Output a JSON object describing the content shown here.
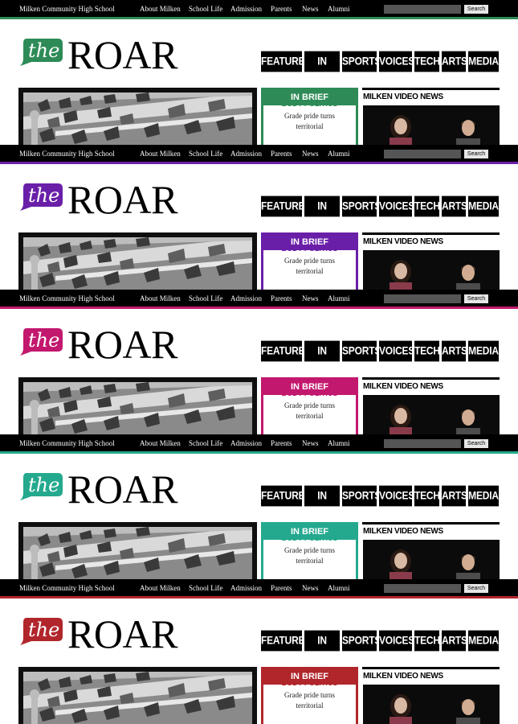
{
  "topbar": {
    "school_name": "Milken Community High School",
    "links": [
      "About Milken",
      "School Life",
      "Admission",
      "Parents",
      "News",
      "Alumni"
    ],
    "search_placeholder": "",
    "search_button": "Search"
  },
  "logo": {
    "the_text": "the",
    "roar_text": "ROAR"
  },
  "main_nav": [
    "FEATURES",
    "IN BRIEF",
    "SPORTS",
    "VOICES",
    "TECH",
    "ARTS",
    "MEDIA"
  ],
  "in_brief": {
    "header": "IN BRIEF",
    "article_title": "BODY POLITICS",
    "article_text_line1": "Grade pride turns",
    "article_text_line2": "territorial"
  },
  "video": {
    "title": "MILKEN VIDEO NEWS"
  },
  "theme_variants": [
    {
      "name": "green",
      "accent": "#2e8b57"
    },
    {
      "name": "purple",
      "accent": "#6a1fa8"
    },
    {
      "name": "magenta",
      "accent": "#c2186e"
    },
    {
      "name": "teal",
      "accent": "#25a98e"
    },
    {
      "name": "red",
      "accent": "#b0262b"
    }
  ]
}
